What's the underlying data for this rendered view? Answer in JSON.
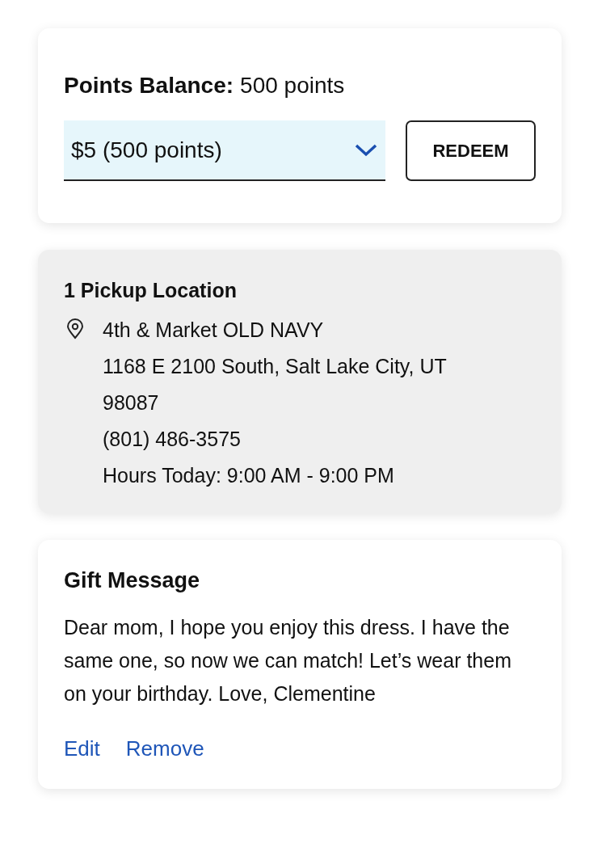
{
  "points_balance": {
    "label": "Points Balance:",
    "value": "500 points"
  },
  "reward_select": {
    "value": "$5 (500 points)"
  },
  "redeem_button": {
    "label": "REDEEM"
  },
  "pickup": {
    "title": "1 Pickup Location",
    "store": "4th & Market OLD NAVY",
    "address": "1168 E 2100 South, Salt Lake City, UT 98087",
    "phone": "(801) 486-3575",
    "hours": "Hours Today: 9:00 AM - 9:00 PM"
  },
  "gift_message": {
    "title": "Gift Message",
    "message": "Dear mom, I hope you enjoy this dress. I have the same one, so now we can match! Let’s wear them on your birthday. Love, Clementine",
    "links": [
      {
        "label": "Edit"
      },
      {
        "label": "Remove"
      }
    ]
  }
}
